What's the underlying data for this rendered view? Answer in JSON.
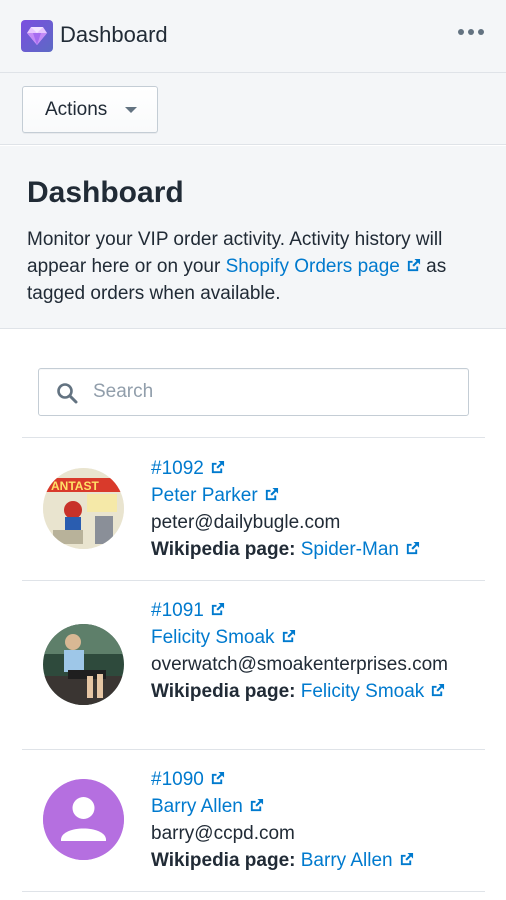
{
  "app": {
    "title": "Dashboard",
    "logo_icon": "gem-icon"
  },
  "actions": {
    "label": "Actions"
  },
  "header": {
    "title": "Dashboard",
    "desc_before": "Monitor your VIP order activity. Activity history will appear here or on your ",
    "desc_link": "Shopify Orders page",
    "desc_after": " as tagged orders when available."
  },
  "search": {
    "placeholder": "Search"
  },
  "colors": {
    "link": "#007ace",
    "avatar_purple": "#b56fe0"
  },
  "customers": [
    {
      "order": "#1092",
      "name": "Peter Parker",
      "email": "peter@dailybugle.com",
      "wiki_label": "Wikipedia page:",
      "wiki_link": "Spider-Man",
      "avatar": "comic-cover-avatar"
    },
    {
      "order": "#1091",
      "name": "Felicity Smoak",
      "email": "overwatch@smoakenterprises.com",
      "wiki_label": "Wikipedia page:",
      "wiki_link": "Felicity Smoak",
      "avatar": "photo-avatar"
    },
    {
      "order": "#1090",
      "name": "Barry Allen",
      "email": "barry@ccpd.com",
      "wiki_label": "Wikipedia page:",
      "wiki_link": "Barry Allen",
      "avatar": "default-person-avatar"
    }
  ]
}
